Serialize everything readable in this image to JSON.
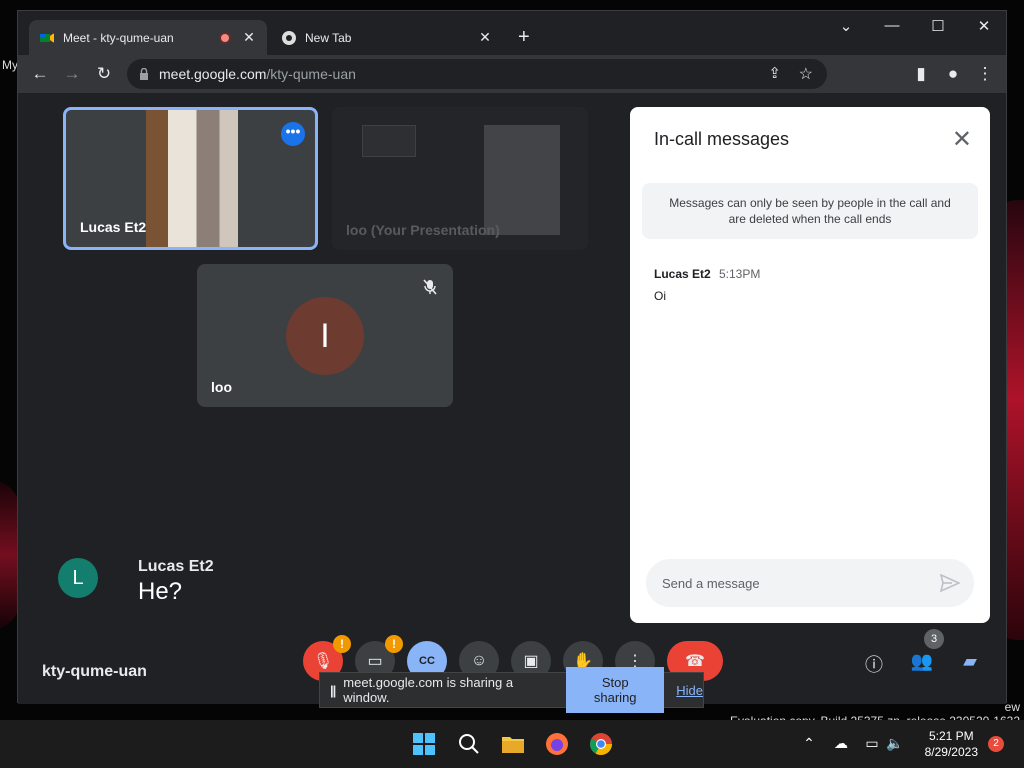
{
  "browser": {
    "tabs": [
      {
        "title": "Meet - kty-qume-uan",
        "active": true
      },
      {
        "title": "New Tab",
        "active": false
      }
    ],
    "url": {
      "host": "meet.google.com",
      "path": "/kty-qume-uan"
    }
  },
  "meet": {
    "tiles": [
      {
        "name": "Lucas Et2"
      },
      {
        "name": "loo (Your Presentation)"
      },
      {
        "name": "loo",
        "avatar_letter": "I"
      }
    ],
    "caption": {
      "avatar_letter": "L",
      "speaker": "Lucas Et2",
      "text": "He?"
    },
    "meeting_code": "kty-qume-uan",
    "people_count": "3",
    "controls": [
      "mic-off",
      "camera-off",
      "captions",
      "emoji",
      "present",
      "raise-hand",
      "more-options",
      "end-call"
    ],
    "warning_mark": "!"
  },
  "chat": {
    "title": "In-call messages",
    "notice": "Messages can only be seen by people in the call and are deleted when the call ends",
    "messages": [
      {
        "sender": "Lucas Et2",
        "time": "5:13PM",
        "text": "Oi"
      }
    ],
    "input_placeholder": "Send a message"
  },
  "share_bar": {
    "text": "meet.google.com is sharing a window.",
    "stop_label": "Stop sharing",
    "hide_label": "Hide"
  },
  "desktop": {
    "watermark_line1": "ew",
    "watermark_line2": "Evaluation copy. Build 25375.zn_release.230520-1632",
    "left_label": "My"
  },
  "taskbar": {
    "time": "5:21 PM",
    "date": "8/29/2023",
    "notification_count": "2"
  },
  "colors": {
    "accent_blue": "#8ab4f8",
    "end_call_red": "#ea4335",
    "warning_orange": "#f29900",
    "meet_bg": "#202124"
  }
}
